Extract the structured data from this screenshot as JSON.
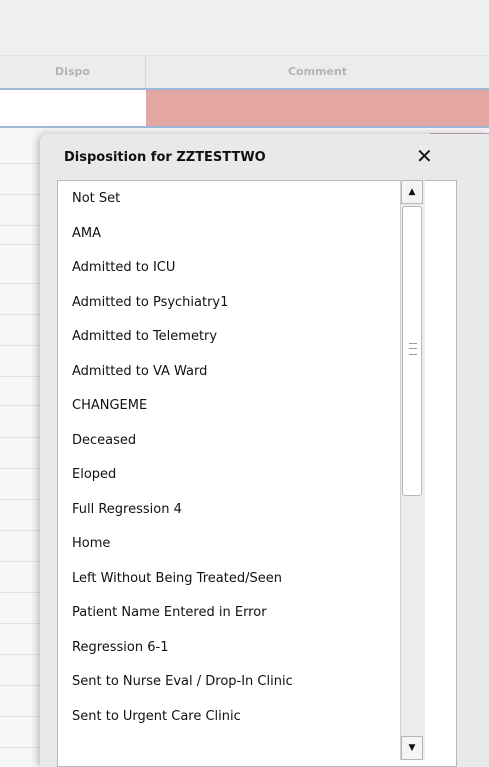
{
  "table": {
    "headers": {
      "dispo": "Dispo",
      "comment": "Comment"
    },
    "row_colors": {
      "comment_selected": "#e3a6a2",
      "purple": "#c8a6c8",
      "yellow": "#eeee66",
      "pink": "#e3a6a2"
    }
  },
  "dialog": {
    "title": "Disposition for ZZTESTTWO",
    "close_symbol": "✕",
    "options": [
      "Not Set",
      "AMA",
      "Admitted to ICU",
      "Admitted to Psychiatry1",
      "Admitted to Telemetry",
      "Admitted to VA Ward",
      "CHANGEME",
      "Deceased",
      "Eloped",
      "Full Regression 4",
      "Home",
      "Left Without Being Treated/Seen",
      "Patient Name Entered in Error",
      "Regression 6-1",
      "Sent to Nurse Eval / Drop-In Clinic",
      "Sent to Urgent Care Clinic"
    ]
  },
  "scrollbar": {
    "up_arrow": "▲",
    "down_arrow": "▼"
  }
}
